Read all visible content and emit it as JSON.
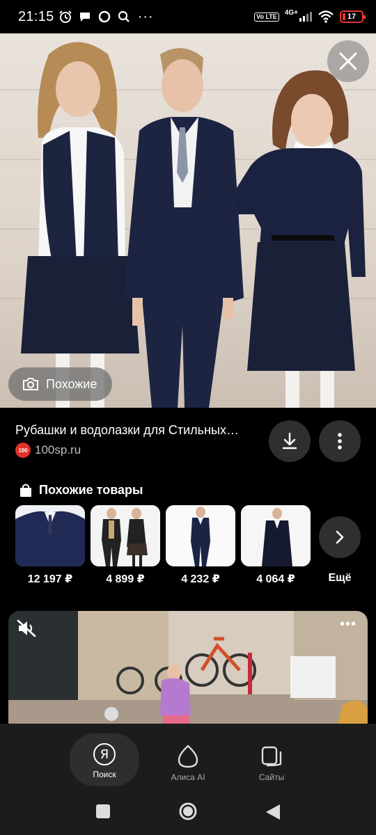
{
  "status_bar": {
    "time": "21:15",
    "volte": "Vo LTE",
    "network": "4G+",
    "battery": "17"
  },
  "hero": {
    "close_icon": "close-icon",
    "similar_label": "Похожие"
  },
  "result": {
    "title": "Рубашки и водолазки для Стильных…",
    "source_logo": "100",
    "source_domain": "100sp.ru"
  },
  "similar_products": {
    "heading": "Похожие товары",
    "items": [
      {
        "price": "12 197 ₽"
      },
      {
        "price": "4 899 ₽"
      },
      {
        "price": "4 232 ₽"
      },
      {
        "price": "4 064 ₽"
      }
    ],
    "more_label": "Ещё"
  },
  "video": {
    "menu_label": "•••"
  },
  "bottom_nav": {
    "items": [
      {
        "label": "Поиск",
        "logo": "Я"
      },
      {
        "label": "Алиса AI"
      },
      {
        "label": "Сайты"
      }
    ]
  },
  "colors": {
    "background": "#000000",
    "panel": "#1c1c1c",
    "button": "#2f2f2f",
    "battery_low": "#e53935",
    "source_logo": "#e0322a"
  }
}
